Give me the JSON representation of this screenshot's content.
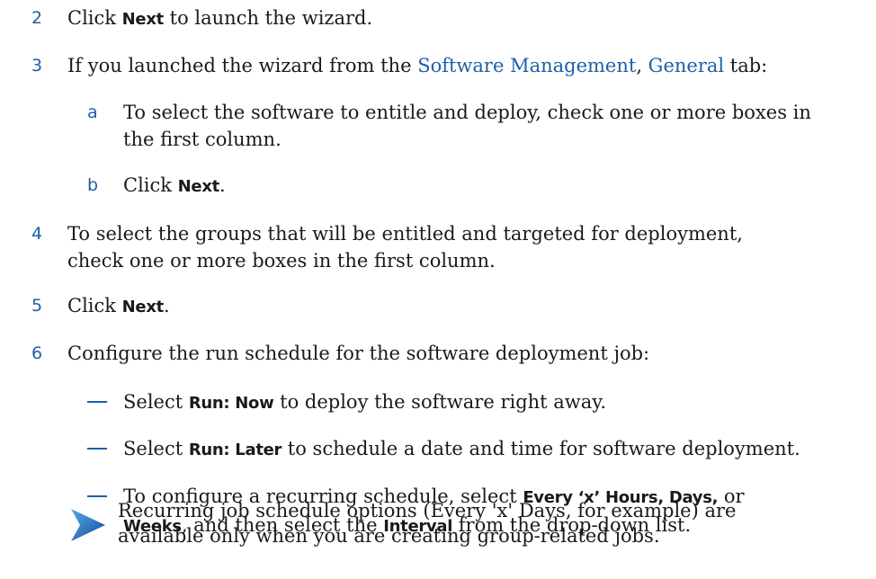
{
  "colors": {
    "accent": "#1f5fa8",
    "text": "#1a1a1a"
  },
  "steps": [
    {
      "num": "2",
      "pre": "Click ",
      "ui": "Next",
      "post": " to launch the wizard."
    },
    {
      "num": "3",
      "pre": "If you launched the wizard from the ",
      "link1": "Software Management",
      "mid": ", ",
      "link2": "General",
      "post": " tab:"
    },
    {
      "num": "4",
      "line1": "To select the groups that will be entitled and targeted for deployment,",
      "line2": "check one or more boxes in the first column."
    },
    {
      "num": "5",
      "pre": "Click ",
      "ui": "Next",
      "post": "."
    },
    {
      "num": "6",
      "text": "Configure the run schedule for the software deployment job:"
    }
  ],
  "substeps": [
    {
      "letter": "a",
      "line1": "To select the software to entitle and deploy, check one or more boxes in",
      "line2": "the first column."
    },
    {
      "letter": "b",
      "pre": "Click ",
      "ui": "Next",
      "post": "."
    }
  ],
  "bullets": [
    {
      "pre": "Select ",
      "ui": "Run: Now",
      "post": " to deploy the software right away."
    },
    {
      "pre": "Select ",
      "ui": "Run: Later",
      "post": " to schedule a date and time for software deployment."
    },
    {
      "pre": "To configure a recurring schedule, select ",
      "ui1": "Every ‘x’ Hours, Days,",
      "mid": " or",
      "ui2": "Weeks",
      "mid2": ", and then select the ",
      "ui3": "Interval",
      "post": " from the drop-down list."
    }
  ],
  "note": {
    "icon": "arrow-note-icon",
    "line1": "Recurring job schedule options (Every 'x' Days, for example) are",
    "line2": "available only when you are creating group-related jobs."
  }
}
